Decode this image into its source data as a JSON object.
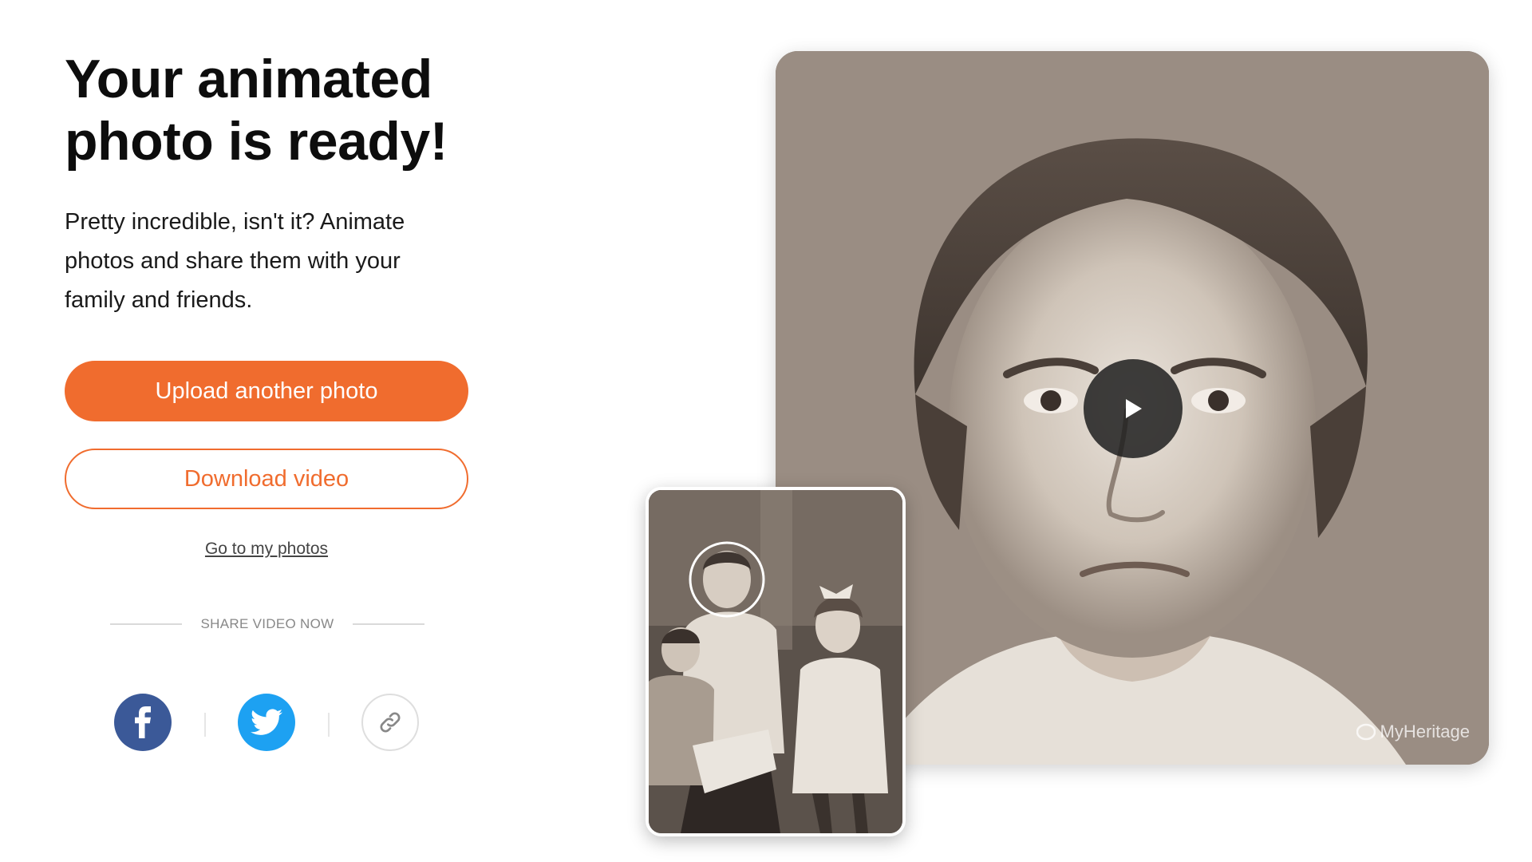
{
  "heading": {
    "line1": "Your animated",
    "line2": "photo is ready!"
  },
  "subtitle": "Pretty incredible, isn't it? Animate photos and share them with your family and friends.",
  "buttons": {
    "upload_label": "Upload another photo",
    "download_label": "Download video"
  },
  "links": {
    "my_photos": "Go to my photos"
  },
  "share": {
    "label": "SHARE VIDEO NOW",
    "items": [
      {
        "name": "facebook",
        "icon": "facebook-icon",
        "color": "#3b5998"
      },
      {
        "name": "twitter",
        "icon": "twitter-icon",
        "color": "#1da1f2"
      },
      {
        "name": "copy-link",
        "icon": "link-icon",
        "color": "#ffffff"
      }
    ]
  },
  "media": {
    "watermark": "MyHeritage",
    "play_icon": "play-icon"
  },
  "colors": {
    "accent": "#f06c2e"
  }
}
